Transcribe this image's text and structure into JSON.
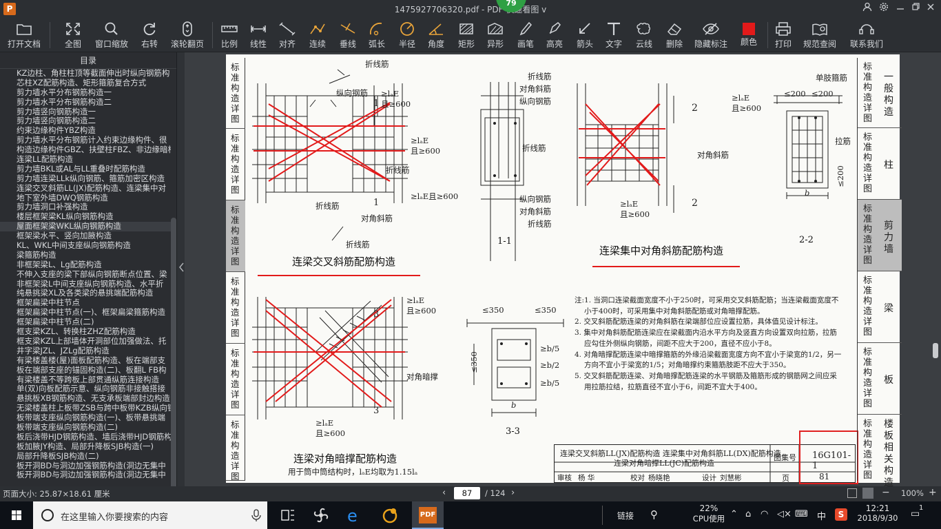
{
  "window": {
    "title": "1475927706320.pdf - PDF 快速看图 v",
    "badge": "79",
    "logo": "P"
  },
  "toolbar": {
    "open": "打开文档",
    "fit": "全图",
    "window_zoom": "窗口缩放",
    "rotate": "右转",
    "scroll_page": "滚轮翻页",
    "scale": "比例",
    "linear": "线性",
    "align": "对齐",
    "continuous": "连续",
    "perpendicular": "垂线",
    "arc": "弧长",
    "radius": "半径",
    "angle": "角度",
    "rect": "矩形",
    "shape": "异形",
    "pen": "画笔",
    "highlight": "高亮",
    "arrow": "箭头",
    "text": "文字",
    "cloud": "云线",
    "delete": "删除",
    "hide_marks": "隐藏标注",
    "color": "颜色",
    "print": "打印",
    "spec_lookup": "规范查阅",
    "contact": "联系我们",
    "color_value": "#e21a1a"
  },
  "sidebar": {
    "title": "目录",
    "items": [
      "KZ边柱、角柱柱顶等截面伸出时纵向钢筋构",
      "芯柱XZ配筋构造、矩形箍筋复合方式",
      "剪力墙水平分布钢筋构造一",
      "剪力墙水平分布钢筋构造二",
      "剪力墙竖向钢筋构造一",
      "剪力墙竖向钢筋构造二",
      "约束边缘构件YBZ构造",
      "剪力墙水平分布钢筋计入约束边缘构件、很",
      "构造边缘构件GBZ、扶壁柱FBZ、非边缘暗柱",
      "连梁LL配筋构造",
      "剪力墙BKL或AL与LL重叠时配筋构造",
      "剪力墙连梁LLk纵向钢筋、箍筋加密区构造",
      "连梁交叉斜筋LL(JX)配筋构造、连梁集中对",
      "地下室外墙DWQ钢筋构造",
      "剪力墙洞口补强构造",
      "楼层框架梁KL纵向钢筋构造",
      "屋面框架梁WKL纵向钢筋构造",
      "框架梁水平、竖向加腋构造",
      "KL、WKL中间支座纵向钢筋构造",
      "梁箍筋构造",
      "非框架梁L、Lg配筋构造",
      "不伸入支座的梁下部纵向钢筋断点位置、梁",
      "非框架梁L中间支座纵向钢筋构造、水平折",
      "纯悬挑梁XL及各类梁的悬挑端配筋构造",
      "框架扁梁中柱节点",
      "框架扁梁中柱节点(一)、框架扁梁箍筋构造",
      "框架扁梁中柱节点(二)",
      "框支梁KZL、转换柱ZHZ配筋构造",
      "框支梁KZL上部墙体开洞部位加强做法、托",
      "井字梁JZL、JZLg配筋构造",
      "有梁楼盖楼(屋)面板配筋构造、板在端部支",
      "板在端部支座的锚固构造(二)、板翻L FB构",
      "有梁楼盖不等跨板上部贯通纵筋连接构造",
      "单(双)向板配筋示意、纵向钢筋非接触搭接",
      "悬挑板XB钢筋构造、无支承板端部封边构造",
      "无梁楼盖柱上板带ZSB与跨中板带KZB纵向钢",
      "板带端支座纵向钢筋构造(一)、板带悬挑端",
      "板带端支座纵向钢筋构造(二)",
      "板后浇带HJD钢筋构造、墙后浇带HJD钢筋构",
      "板加腋JY构造、局部升降板SJB构造(一)",
      "局部升降板SJB构造(二)",
      "板开洞BD与洞边加强钢筋构造(洞边无集中",
      "板开洞BD与洞边加强钢筋构造(洞边无集中"
    ],
    "selected_index": 16
  },
  "page": {
    "left_tab_text": [
      "标准构造详图",
      "标准构造详图",
      "标准构造详图",
      "标准构造详图",
      "标准构造详图",
      "标准构造详图"
    ],
    "right_tabs": [
      {
        "v": "标准构造详图",
        "c": "一般构造"
      },
      {
        "v": "标准构造详图",
        "c": "柱"
      },
      {
        "v": "标准构造详图",
        "c": "剪力墙"
      },
      {
        "v": "标准构造详图",
        "c": "梁"
      },
      {
        "v": "标准构造详图",
        "c": "板"
      },
      {
        "v": "标准构造详图",
        "c": "楼板相关构造"
      }
    ],
    "captions": {
      "cross_bars": "连梁交叉斜筋配筋构造",
      "concentrated": "连梁集中对角斜筋配筋构造",
      "dark_brace": "连梁对角暗撑配筋构造",
      "dark_brace_note": "用于筒中筒结构时，lₐE均取为1.15lₐ",
      "sec11": "1-1",
      "sec22": "2-2",
      "sec33": "3-3"
    },
    "labels": {
      "bent_bar": "折线筋",
      "long_bar": "纵向钢筋",
      "diag_bar": "对角斜筋",
      "single_stirrup": "单肢箍筋",
      "tie_bar": "拉筋",
      "diag_brace": "对角暗撑",
      "anchor1": "≥lₐE",
      "anchor2": "且≥600",
      "anchor_full": "≥lₐE且≥600",
      "d200": "≤200",
      "d350": "≤350",
      "b": "b",
      "b5": "≥b/5",
      "b2": "≥b/2",
      "n1": "1",
      "n2": "2",
      "n3": "3"
    },
    "notes": [
      "注:1. 当洞口连梁截面宽度不小于250时，可采用交叉斜筋配筋；当连梁截面宽度不小于400时，可采用集中对角斜筋配筋或对角暗撑配筋。",
      "2. 交叉斜筋配筋连梁的对角斜筋在梁端部位应设置拉筋，具体值见设计标注。",
      "3. 集中对角斜筋配筋连梁应在梁截面内沿水平方向及竖直方向设置双向拉筋，拉筋应勾住外侧纵向钢筋，间距不应大于200，直径不应小于8。",
      "4. 对角暗撑配筋连梁中暗撑箍筋的外缘沿梁截面宽度方向不宜小于梁宽的1/2，另一方向不宜小于梁宽的1/5；对角暗撑约束箍筋肢距不应大于350。",
      "5. 交叉斜筋配筋连梁、对角暗撑配筋连梁的水平钢筋及箍筋形成的钢筋网之间应采用拉筋拉结，拉筋直径不宜小于6，间距不宜大于400。"
    ],
    "titleblock": {
      "line1": "连梁交叉斜筋LL(JX)配筋构造  连梁集中对角斜筋LL(DX)配筋构造",
      "line2": "连梁对角暗撑LL(JC)配筋构造",
      "atlas_label": "图集号",
      "atlas_no": "16G101-1",
      "page_label": "页",
      "page_no": "81",
      "review": "审核",
      "reviewer": "杨  华",
      "check": "校对",
      "checker": "杨晓艳",
      "design": "设计",
      "designer": "刘慧彬"
    }
  },
  "statusbar": {
    "page_size": "页面大小: 25.87×18.61 厘米",
    "current_page": "87",
    "total_pages": "/ 124",
    "zoom": "100%"
  },
  "taskbar": {
    "search_placeholder": "在这里输入你要搜索的内容",
    "link": "链接",
    "cpu_percent": "22%",
    "cpu_label": "CPU使用",
    "ime": "中",
    "time": "12:21",
    "date": "2018/9/30",
    "notif_count": "1"
  }
}
